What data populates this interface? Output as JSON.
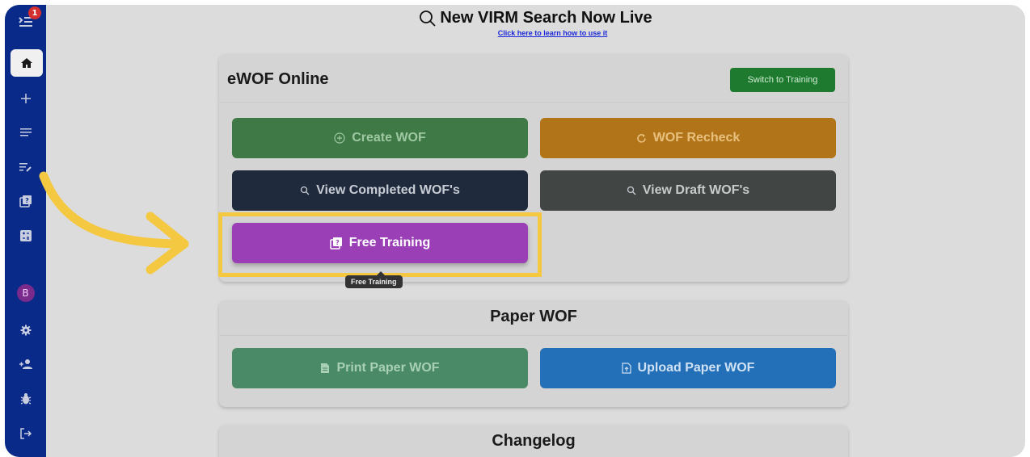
{
  "banner": {
    "title": "New VIRM Search Now Live",
    "link": "Click here to learn how to use it"
  },
  "sidebar": {
    "badge_count": "1",
    "avatar_letter": "B",
    "items": [
      {
        "icon": "menu-collapse-icon"
      },
      {
        "icon": "home-icon",
        "active": true
      },
      {
        "icon": "plus-icon"
      },
      {
        "icon": "list-icon"
      },
      {
        "icon": "edit-list-icon"
      },
      {
        "icon": "training-icon"
      },
      {
        "icon": "calculator-icon"
      },
      {
        "icon": "avatar"
      },
      {
        "icon": "gear-icon"
      },
      {
        "icon": "add-user-icon"
      },
      {
        "icon": "bug-icon"
      },
      {
        "icon": "logout-icon"
      }
    ]
  },
  "ewof": {
    "title": "eWOF Online",
    "switch_label": "Switch to Training",
    "create": "Create WOF",
    "recheck": "WOF Recheck",
    "view_completed": "View Completed WOF's",
    "view_draft": "View Draft WOF's",
    "free_training": "Free Training",
    "tooltip": "Free Training"
  },
  "paper": {
    "title": "Paper WOF",
    "print": "Print Paper WOF",
    "upload": "Upload Paper WOF"
  },
  "changelog": {
    "title": "Changelog"
  },
  "colors": {
    "sidebar": "#0a2a8a",
    "highlight": "#f5c842",
    "training": "#9b3fb6"
  }
}
